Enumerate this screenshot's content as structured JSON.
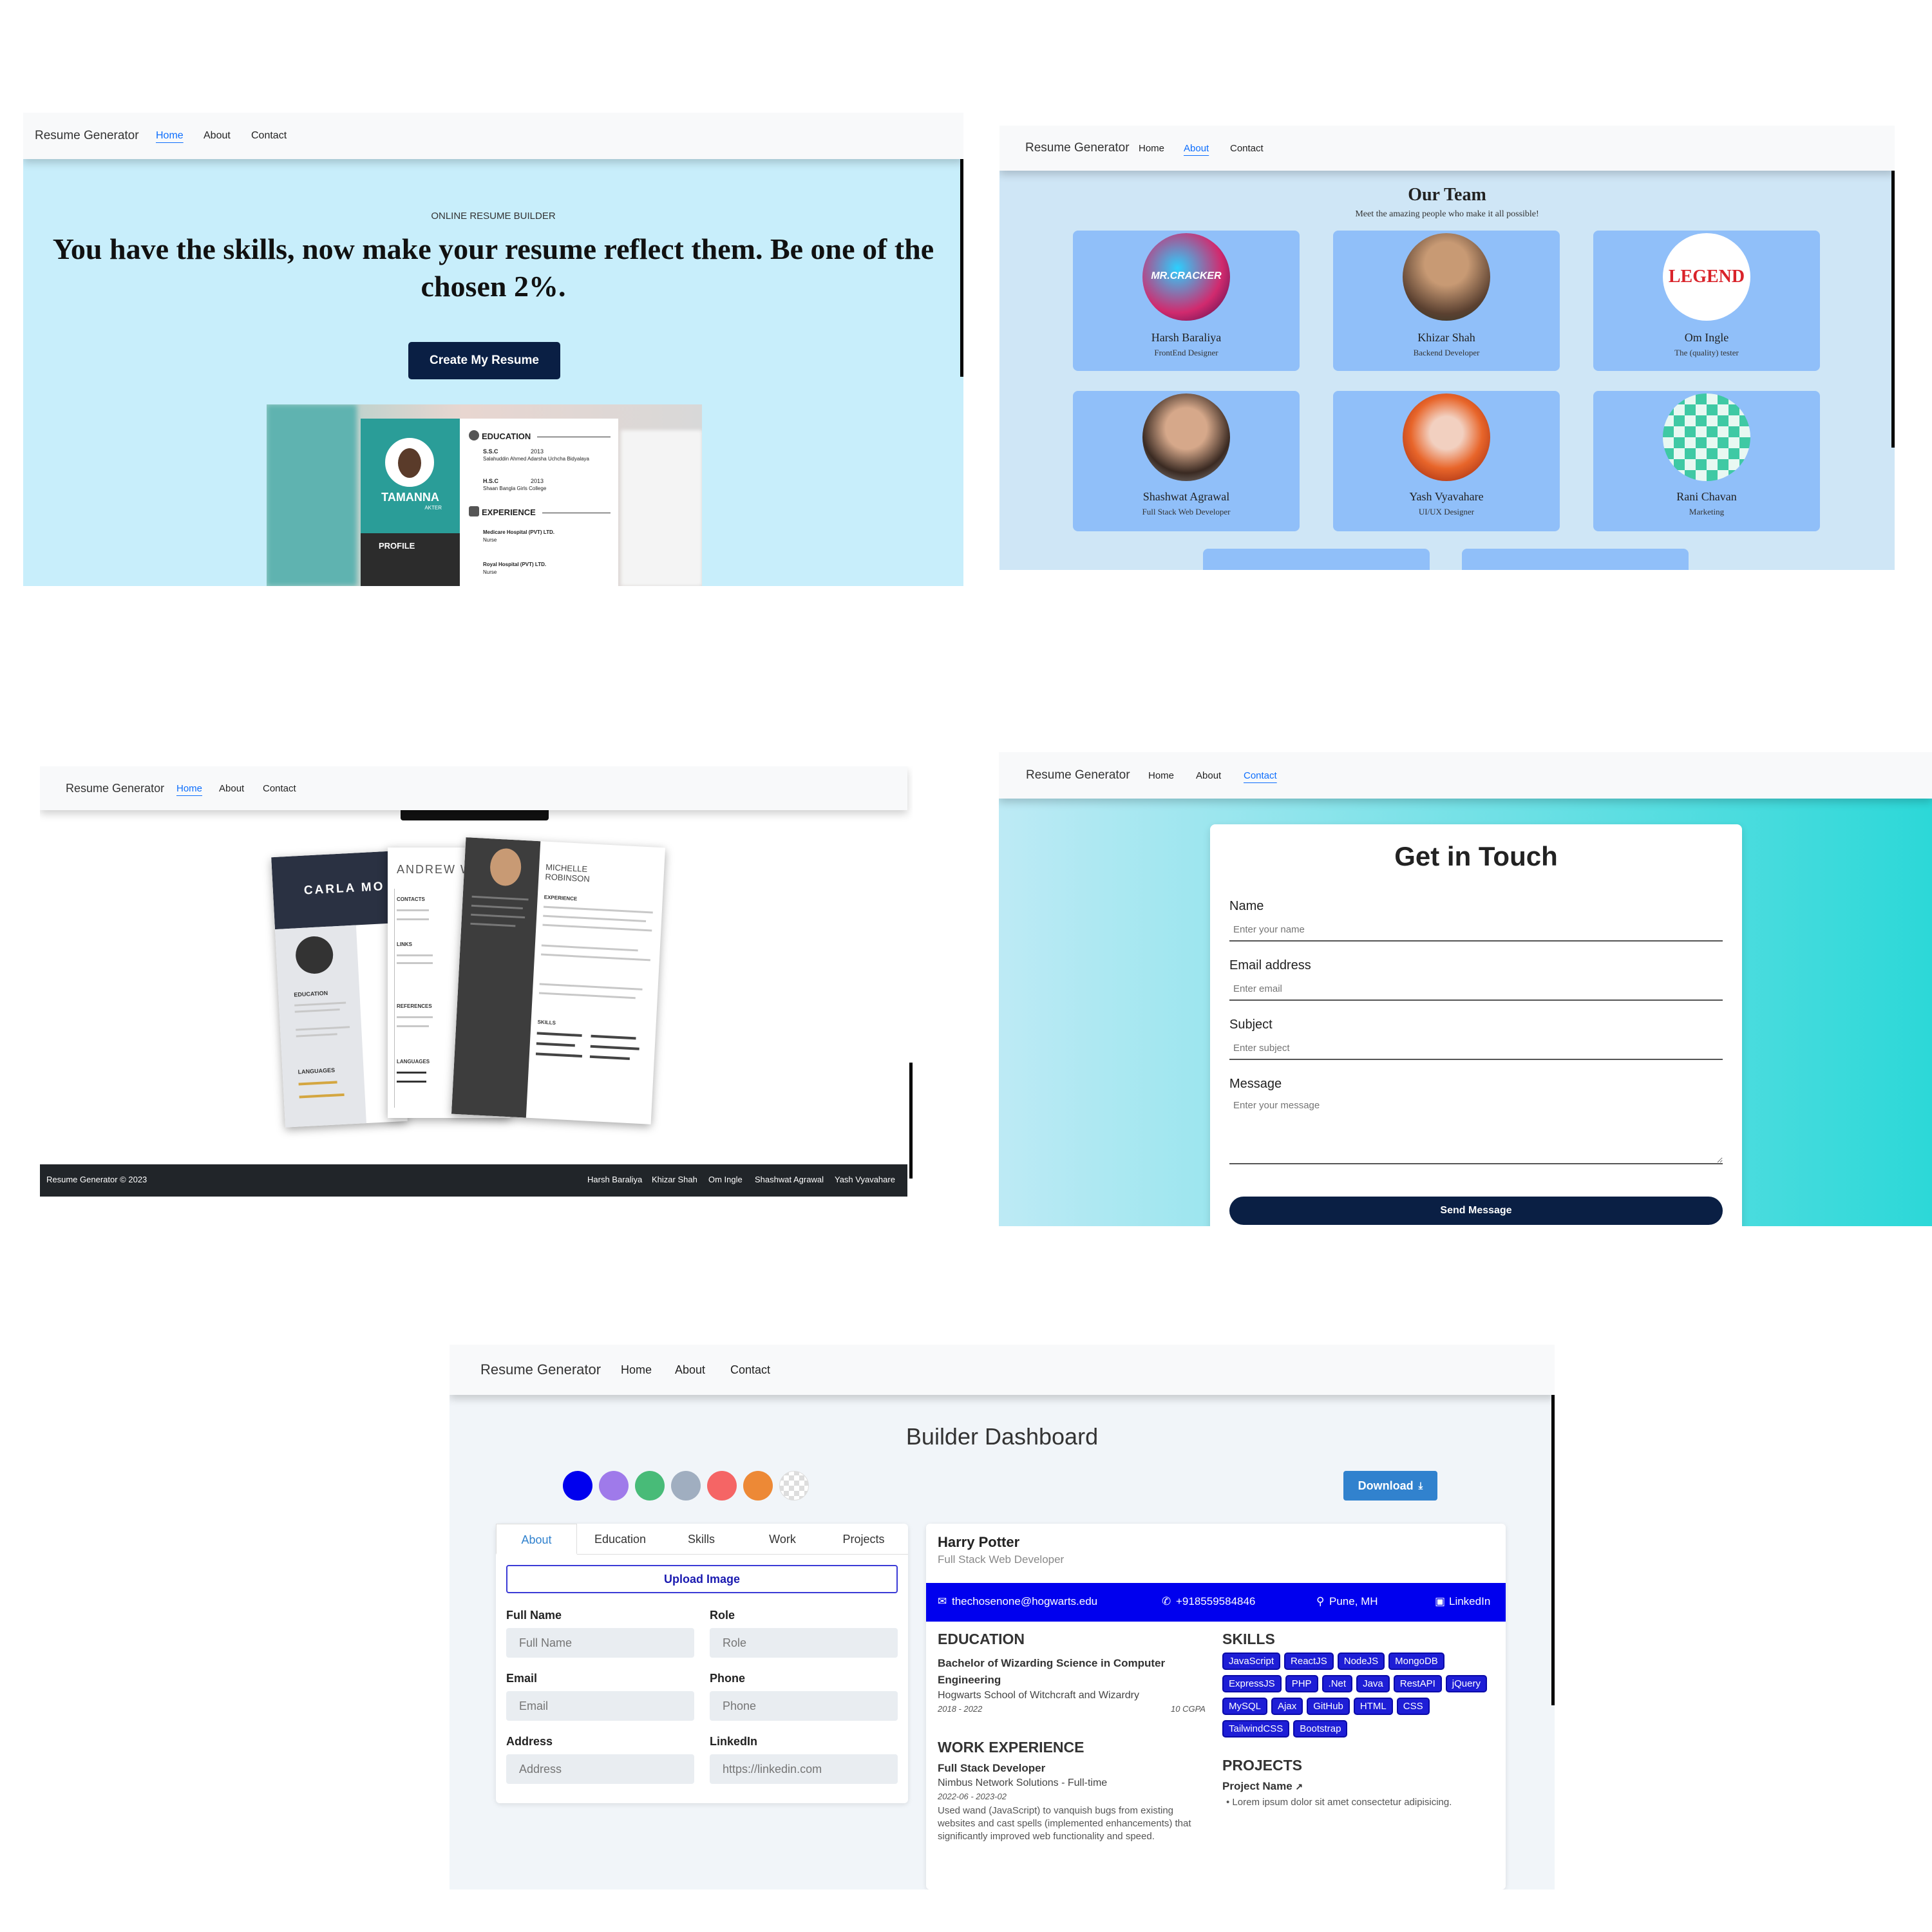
{
  "brand": "Resume Generator",
  "nav": {
    "home": "Home",
    "about": "About",
    "contact": "Contact"
  },
  "home_hero": {
    "eyebrow": "ONLINE RESUME BUILDER",
    "headline": "You have the skills, now make your resume reflect them. Be one of the chosen 2%.",
    "cta": "Create My Resume",
    "preview": {
      "name": "TAMANNA",
      "name_sub": "AKTER",
      "profile": "PROFILE",
      "education": "EDUCATION",
      "experience": "EXPERIENCE",
      "edu_items": [
        "S.S.C",
        "H.S.C"
      ],
      "edu_years": [
        "2013",
        "2013"
      ],
      "edu_schools": [
        "Salahuddin Ahmed Adarsha Uchcha Bidyalaya",
        "Shaan Bangla Girls College"
      ],
      "exp_items": [
        "Medicare Hospital (PVT) LTD.",
        "Royal Hospital (PVT) LTD."
      ],
      "exp_roles": [
        "Nurse",
        "Nurse"
      ]
    }
  },
  "about": {
    "title": "Our Team",
    "subtitle": "Meet the amazing people who make it all possible!",
    "members": [
      {
        "name": "Harsh Baraliya",
        "role": "FrontEnd Designer",
        "avatar_text": "MR.CRACKER",
        "color": "#d12a6e"
      },
      {
        "name": "Khizar Shah",
        "role": "Backend Developer",
        "avatar_text": "",
        "color": "#7a5a3a"
      },
      {
        "name": "Om Ingle",
        "role": "The (quality) tester",
        "avatar_text": "LEGEND",
        "color": "#d9232a"
      },
      {
        "name": "Shashwat Agrawal",
        "role": "Full Stack Web Developer",
        "avatar_text": "",
        "color": "#8a6a4a"
      },
      {
        "name": "Yash Vyavahare",
        "role": "UI/UX Designer",
        "avatar_text": "",
        "color": "#e8652a"
      },
      {
        "name": "Rani Chavan",
        "role": "Marketing",
        "avatar_text": "",
        "color": "#3fc9a4"
      }
    ]
  },
  "home_templates": {
    "names": [
      "CARLA MO",
      "ANDREW WAT",
      "MICHELLE ROBINSON"
    ],
    "labels": [
      "EDUCATION",
      "LANGUAGES",
      "CONTACTS",
      "LINKS",
      "REFERENCES",
      "EXPERIENCE",
      "SKILLS"
    ],
    "footer_left": "Resume Generator © 2023",
    "footer_links": [
      "Harsh Baraliya",
      "Khizar Shah",
      "Om Ingle",
      "Shashwat Agrawal",
      "Yash Vyavahare"
    ]
  },
  "contact": {
    "title": "Get in Touch",
    "name_label": "Name",
    "name_placeholder": "Enter your name",
    "email_label": "Email address",
    "email_placeholder": "Enter email",
    "subject_label": "Subject",
    "subject_placeholder": "Enter subject",
    "message_label": "Message",
    "message_placeholder": "Enter your message",
    "submit": "Send Message"
  },
  "dashboard": {
    "title": "Builder Dashboard",
    "swatches": [
      "#0000ee",
      "#9f7aea",
      "#48bb78",
      "#a0aec0",
      "#f56565",
      "#ed8936"
    ],
    "download": "Download",
    "tabs": [
      "About",
      "Education",
      "Skills",
      "Work",
      "Projects"
    ],
    "upload": "Upload Image",
    "fields": {
      "full_name": {
        "label": "Full Name",
        "placeholder": "Full Name"
      },
      "role": {
        "label": "Role",
        "placeholder": "Role"
      },
      "email": {
        "label": "Email",
        "placeholder": "Email"
      },
      "phone": {
        "label": "Phone",
        "placeholder": "Phone"
      },
      "address": {
        "label": "Address",
        "placeholder": "Address"
      },
      "linkedin": {
        "label": "LinkedIn",
        "placeholder": "https://linkedin.com"
      }
    },
    "resume": {
      "name": "Harry Potter",
      "role": "Full Stack Web Developer",
      "email": "thechosenone@hogwarts.edu",
      "phone": "+918559584846",
      "location": "Pune, MH",
      "linkedin": "LinkedIn",
      "education_h": "EDUCATION",
      "degree": "Bachelor of Wizarding Science in Computer Engineering",
      "school": "Hogwarts School of Witchcraft and Wizardry",
      "edu_years": "2018 - 2022",
      "cgpa": "10 CGPA",
      "work_h": "WORK EXPERIENCE",
      "job_title": "Full Stack Developer",
      "company": "Nimbus Network Solutions - Full-time",
      "job_years": "2022-06 - 2023-02",
      "job_desc": "Used wand (JavaScript) to vanquish bugs from existing websites and cast spells (implemented enhancements) that significantly improved web functionality and speed.",
      "skills_h": "SKILLS",
      "skills": [
        "JavaScript",
        "ReactJS",
        "NodeJS",
        "MongoDB",
        "ExpressJS",
        "PHP",
        ".Net",
        "Java",
        "RestAPI",
        "jQuery",
        "MySQL",
        "Ajax",
        "GitHub",
        "HTML",
        "CSS",
        "TailwindCSS",
        "Bootstrap"
      ],
      "projects_h": "PROJECTS",
      "project_name": "Project Name",
      "project_desc": "Lorem ipsum dolor sit amet consectetur adipisicing."
    }
  }
}
